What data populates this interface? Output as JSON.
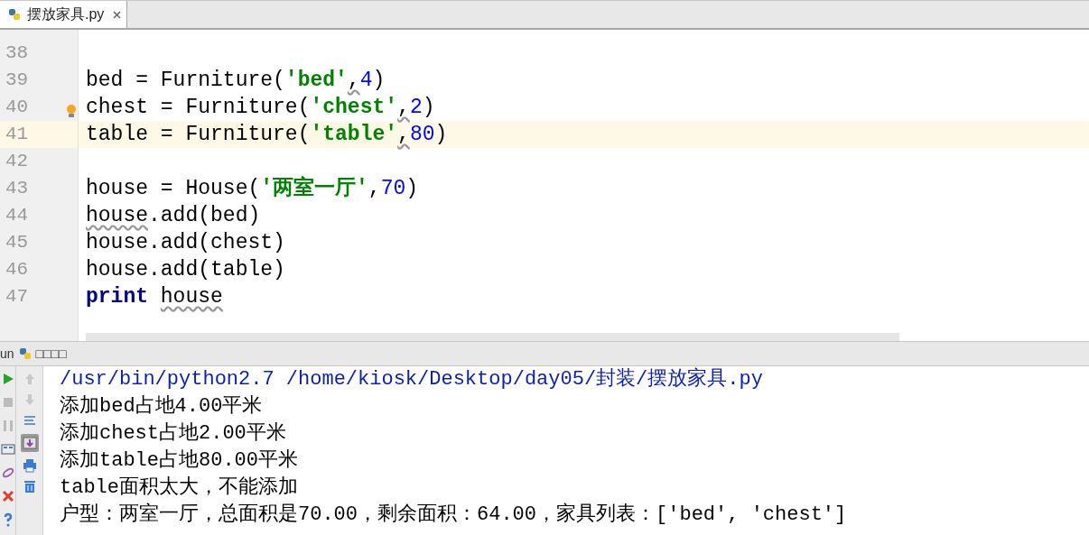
{
  "tabs": [
    {
      "label": "摆放家具.py",
      "selected": true
    }
  ],
  "editor": {
    "lines": [
      {
        "number": "38",
        "current": false
      },
      {
        "number": "39",
        "current": false,
        "tokens": [
          {
            "kind": "plain",
            "text": "bed = Furniture("
          },
          {
            "kind": "string",
            "text": "'bed'"
          },
          {
            "kind": "warn",
            "text": ","
          },
          {
            "kind": "number",
            "text": "4"
          },
          {
            "kind": "plain",
            "text": ")"
          }
        ]
      },
      {
        "number": "40",
        "current": false,
        "tokens": [
          {
            "kind": "plain",
            "text": "chest = Furniture("
          },
          {
            "kind": "string",
            "text": "'chest'"
          },
          {
            "kind": "warn",
            "text": ","
          },
          {
            "kind": "number",
            "text": "2"
          },
          {
            "kind": "plain",
            "text": ")"
          }
        ]
      },
      {
        "number": "41",
        "current": true,
        "tokens": [
          {
            "kind": "plain",
            "text": "table = Furniture("
          },
          {
            "kind": "string",
            "text": "'table'"
          },
          {
            "kind": "warn",
            "text": ","
          },
          {
            "kind": "number",
            "text": "80"
          },
          {
            "kind": "plain",
            "text": ")"
          }
        ]
      },
      {
        "number": "42",
        "current": false
      },
      {
        "number": "43",
        "current": false,
        "tokens": [
          {
            "kind": "plain",
            "text": "house = House("
          },
          {
            "kind": "string",
            "text": "'两室一厅'"
          },
          {
            "kind": "plain",
            "text": ","
          },
          {
            "kind": "number",
            "text": "70"
          },
          {
            "kind": "plain",
            "text": ")"
          }
        ]
      },
      {
        "number": "44",
        "current": false,
        "tokens": [
          {
            "kind": "warn",
            "text": "house"
          },
          {
            "kind": "plain",
            "text": ".add(bed)"
          }
        ]
      },
      {
        "number": "45",
        "current": false,
        "tokens": [
          {
            "kind": "plain",
            "text": "house.add(chest)"
          }
        ]
      },
      {
        "number": "46",
        "current": false,
        "tokens": [
          {
            "kind": "plain",
            "text": "house.add(table)"
          }
        ]
      },
      {
        "number": "47",
        "current": false,
        "tokens": [
          {
            "kind": "keyword",
            "text": "print"
          },
          {
            "kind": "warn",
            "text": "house"
          }
        ]
      }
    ]
  },
  "run_bar": {
    "label": "un",
    "title": "□□□□"
  },
  "console": {
    "lines": [
      {
        "kind": "command",
        "text": "/usr/bin/python2.7 /home/kiosk/Desktop/day05/封装/摆放家具.py"
      },
      {
        "kind": "output",
        "text": "添加bed占地4.00平米"
      },
      {
        "kind": "output",
        "text": "添加chest占地2.00平米"
      },
      {
        "kind": "output",
        "text": "添加table占地80.00平米"
      },
      {
        "kind": "output",
        "text": "table面积太大，不能添加"
      },
      {
        "kind": "output",
        "text": "户型：两室一厅，总面积是70.00，剩余面积：64.00，家具列表：['bed', 'chest']"
      }
    ]
  }
}
